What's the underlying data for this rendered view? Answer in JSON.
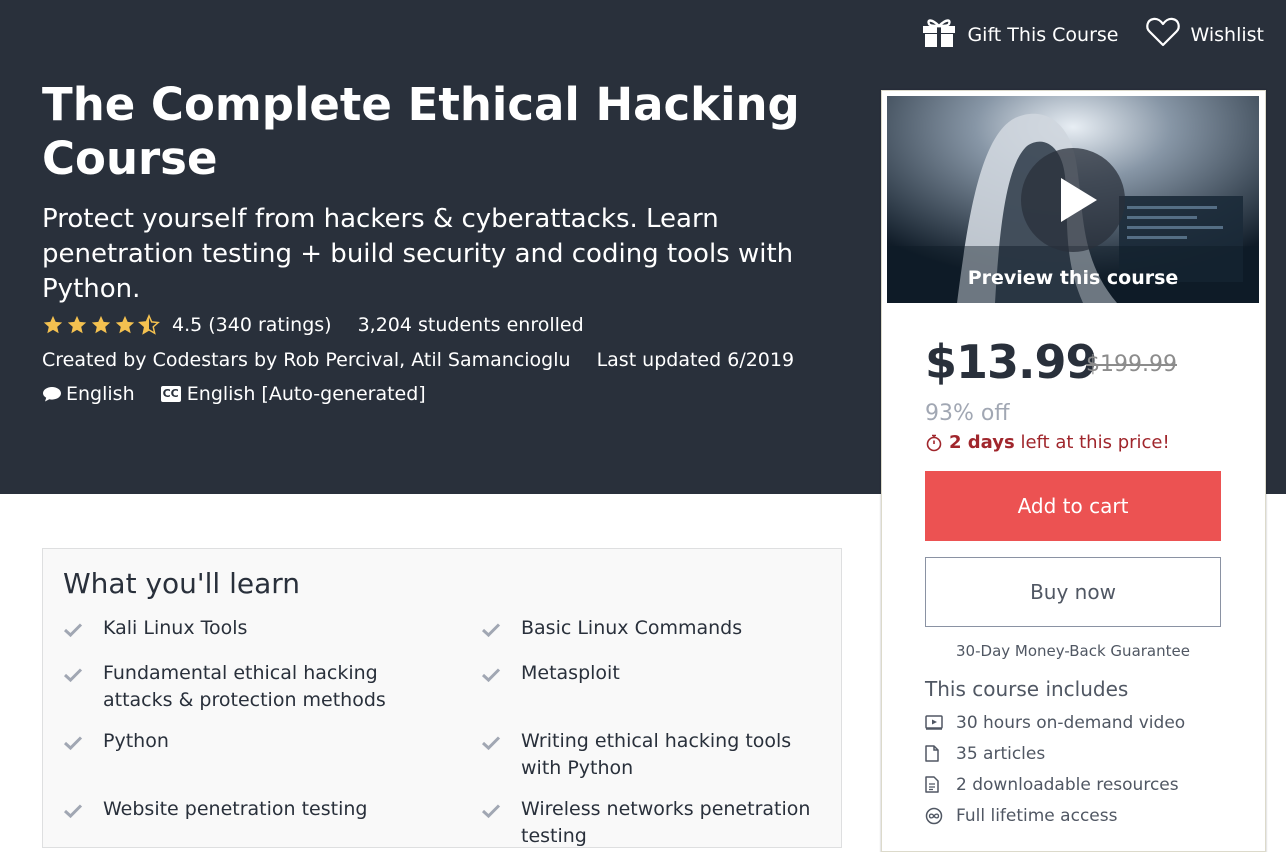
{
  "header": {
    "gift_label": "Gift This Course",
    "wishlist_label": "Wishlist"
  },
  "course": {
    "title": "The Complete Ethical Hacking Course",
    "subtitle": "Protect yourself from hackers & cyberattacks. Learn penetration testing + build security and coding tools with Python.",
    "rating_value": 4.5,
    "rating_text": "4.5 (340 ratings)",
    "enrolled": "3,204 students enrolled",
    "created_by": "Created by Codestars by Rob Percival, Atil Samancioglu",
    "last_updated": "Last updated 6/2019",
    "language": "English",
    "caption_badge": "CC",
    "captions": "English [Auto-generated]"
  },
  "sidebar": {
    "preview_label": "Preview this course",
    "price": "$13.99",
    "original_price": "$199.99",
    "discount": "93% off",
    "deadline_bold": "2 days",
    "deadline_rest": " left at this price!",
    "add_to_cart": "Add to cart",
    "buy_now": "Buy now",
    "guarantee": "30-Day Money-Back Guarantee",
    "includes_title": "This course includes",
    "includes": [
      {
        "icon": "video-icon",
        "label": "30 hours on-demand video"
      },
      {
        "icon": "file-icon",
        "label": "35 articles"
      },
      {
        "icon": "document-icon",
        "label": "2 downloadable resources"
      },
      {
        "icon": "infinity-icon",
        "label": "Full lifetime access"
      }
    ]
  },
  "learn": {
    "title": "What you'll learn",
    "items": [
      "Kali Linux Tools",
      "Basic Linux Commands",
      "Fundamental ethical hacking attacks & protection methods",
      "Metasploit",
      "Python",
      "Writing ethical hacking tools with Python",
      "Website penetration testing",
      "Wireless networks penetration testing"
    ]
  },
  "colors": {
    "hero_bg": "#29303b",
    "accent": "#ec5252",
    "star": "#f4c150",
    "deadline": "#a0262c"
  }
}
